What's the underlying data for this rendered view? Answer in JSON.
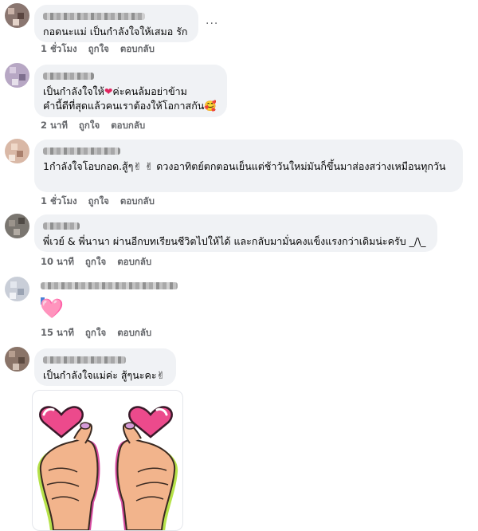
{
  "comments": [
    {
      "text": "กอดนะแม่ เป็นกำลังใจให้เสมอ รัก",
      "time": "1 ชั่วโมง",
      "like": "ถูกใจ",
      "reply": "ตอบกลับ",
      "more": "..."
    },
    {
      "line1": "เป็นกำลังใจให้",
      "heart": "❤",
      "line1b": "ค่ะคนล้มอย่าข้าม",
      "line2": "คำนี้ดีที่สุดแล้วคนเราต้องให้โอกาสกัน🥰",
      "time": "2 นาที",
      "like": "ถูกใจ",
      "reply": "ตอบกลับ"
    },
    {
      "text": "1กำลังใจโอบกอด.สู้ๆ✌ ✌ ดวงอาทิตย์ตกตอนเย็นแต่ช้าวันใหม่มันก็ขึ้นมาส่องสว่างเหมือนทุกวัน",
      "time": "1 ชั่วโมง",
      "like": "ถูกใจ",
      "reply": "ตอบกลับ"
    },
    {
      "text": "พี่เวย์ & พี่นานา ผ่านอีกบทเรียนชีวิตไปให้ได้ และกลับมามั่นคงแข็งแรงกว่าเดิมน่ะครับ _/\\_",
      "time": "10 นาที",
      "like": "ถูกใจ",
      "reply": "ตอบกลับ"
    },
    {
      "emoji": "🩷",
      "time": "15 นาที",
      "like": "ถูกใจ",
      "reply": "ตอบกลับ"
    },
    {
      "text": "เป็นกำลังใจแม่ค่ะ สู้ๆนะคะ✌",
      "sticker": "finger-heart-sticker"
    }
  ],
  "colors": {
    "bubble": "#f0f2f5",
    "meta": "#65676b",
    "heart_pink": "#f0509a"
  }
}
